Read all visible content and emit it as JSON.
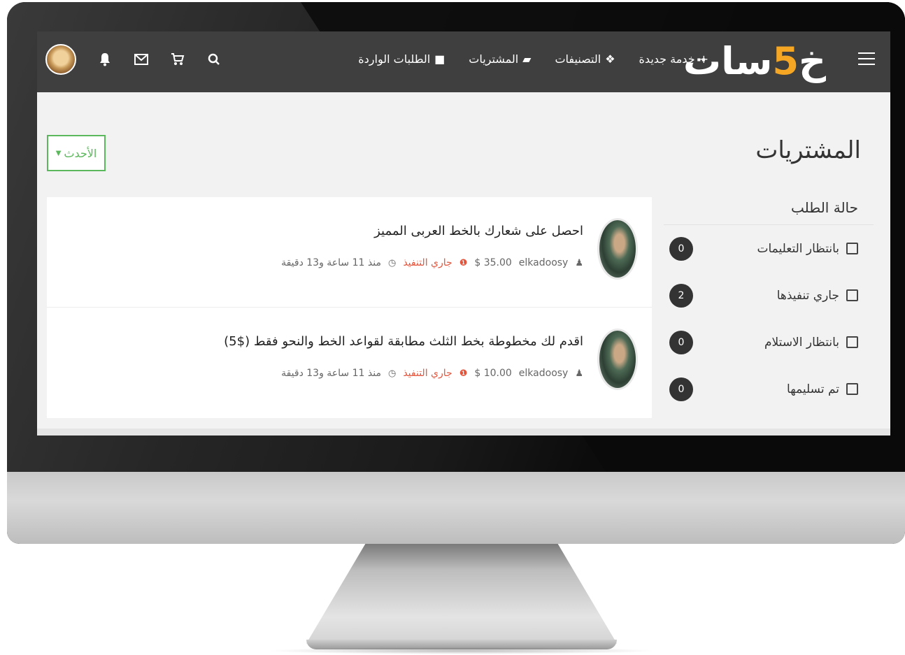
{
  "navbar": {
    "logo_main": "خمسات",
    "logo_accent": "5",
    "links": [
      {
        "label": "خدمة جديدة",
        "icon": "plus-icon"
      },
      {
        "label": "التصنيفات",
        "icon": "cubes-icon"
      },
      {
        "label": "المشتريات",
        "icon": "folder-icon"
      },
      {
        "label": "الطلبات الواردة",
        "icon": "truck-icon"
      }
    ],
    "icons": [
      "avatar",
      "bell-icon",
      "envelope-icon",
      "cart-icon",
      "search-icon"
    ]
  },
  "page": {
    "title": "المشتريات",
    "sort_label": "الأحدث"
  },
  "sidebar": {
    "title": "حالة الطلب",
    "filters": [
      {
        "label": "بانتظار التعليمات",
        "count": "0"
      },
      {
        "label": "جاري تنفيذها",
        "count": "2"
      },
      {
        "label": "بانتظار الاستلام",
        "count": "0"
      },
      {
        "label": "تم تسليمها",
        "count": "0"
      }
    ]
  },
  "orders": [
    {
      "title": "احصل على شعارك بالخط العربى المميز",
      "user": "elkadoosy",
      "price": "35.00 $",
      "status": "جاري التنفيذ",
      "time": "منذ 11 ساعة و13 دقيقة"
    },
    {
      "title": "اقدم لك مخطوطة بخط الثلث مطابقة لقواعد الخط والنحو فقط ($5)",
      "user": "elkadoosy",
      "price": "10.00 $",
      "status": "جاري التنفيذ",
      "time": "منذ 11 ساعة و13 دقيقة"
    }
  ],
  "colors": {
    "navbar": "#3f3f3f",
    "accent": "#f5a623",
    "sort_border": "#5cb85c",
    "status": "#e2553d"
  }
}
